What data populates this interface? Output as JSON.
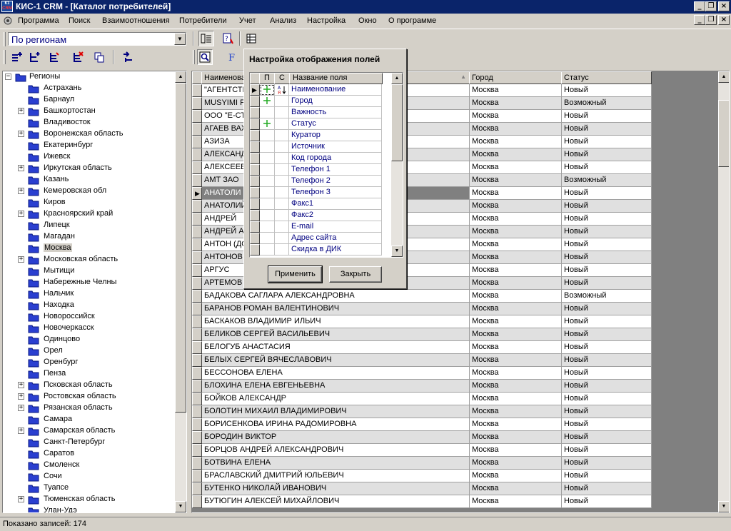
{
  "window": {
    "title": "КИС-1 CRM - [Каталог потребителей]",
    "icon_text": "К1",
    "icon_brand": "CRM"
  },
  "menu": [
    "Программа",
    "Поиск",
    "Взаимоотношения",
    "Потребители",
    "Учет",
    "Анализ",
    "Настройка",
    "Окно",
    "О программе"
  ],
  "toolbar": {
    "group_by": "По регионам"
  },
  "tree": {
    "root": "Регионы",
    "items": [
      {
        "label": "Астрахань",
        "expandable": false
      },
      {
        "label": "Барнаул",
        "expandable": false
      },
      {
        "label": "Башкортостан",
        "expandable": true
      },
      {
        "label": "Владивосток",
        "expandable": false
      },
      {
        "label": "Воронежская область",
        "expandable": true
      },
      {
        "label": "Екатеринбург",
        "expandable": false
      },
      {
        "label": "Ижевск",
        "expandable": false
      },
      {
        "label": "Иркутская область",
        "expandable": true
      },
      {
        "label": "Казань",
        "expandable": false
      },
      {
        "label": "Кемеровская обл",
        "expandable": true
      },
      {
        "label": "Киров",
        "expandable": false
      },
      {
        "label": "Красноярский край",
        "expandable": true
      },
      {
        "label": "Липецк",
        "expandable": false
      },
      {
        "label": "Магадан",
        "expandable": false
      },
      {
        "label": "Москва",
        "expandable": false,
        "selected": true
      },
      {
        "label": "Московская область",
        "expandable": true
      },
      {
        "label": "Мытищи",
        "expandable": false
      },
      {
        "label": "Набережные Челны",
        "expandable": false
      },
      {
        "label": "Нальчик",
        "expandable": false
      },
      {
        "label": "Находка",
        "expandable": false
      },
      {
        "label": "Новороссийск",
        "expandable": false
      },
      {
        "label": "Новочеркасск",
        "expandable": false
      },
      {
        "label": "Одинцово",
        "expandable": false
      },
      {
        "label": "Орел",
        "expandable": false
      },
      {
        "label": "Оренбург",
        "expandable": false
      },
      {
        "label": "Пенза",
        "expandable": false
      },
      {
        "label": "Псковская область",
        "expandable": true
      },
      {
        "label": "Ростовская область",
        "expandable": true
      },
      {
        "label": "Рязанская область",
        "expandable": true
      },
      {
        "label": "Самара",
        "expandable": false
      },
      {
        "label": "Самарская область",
        "expandable": true
      },
      {
        "label": "Санкт-Петербург",
        "expandable": false
      },
      {
        "label": "Саратов",
        "expandable": false
      },
      {
        "label": "Смоленск",
        "expandable": false
      },
      {
        "label": "Сочи",
        "expandable": false
      },
      {
        "label": "Туапсе",
        "expandable": false
      },
      {
        "label": "Тюменская область",
        "expandable": true
      },
      {
        "label": "Улан-Удэ",
        "expandable": false
      }
    ]
  },
  "grid": {
    "columns": [
      "Наименование",
      "Город",
      "Статус"
    ],
    "rows": [
      [
        "\"АГЕНТСТВ",
        "Москва",
        "Новый"
      ],
      [
        "MUSYIMI P",
        "Москва",
        "Возможный"
      ],
      [
        "ООО \"Е-СТ",
        "Москва",
        "Новый"
      ],
      [
        "АГАЕВ ВАХ",
        "Москва",
        "Новый"
      ],
      [
        "АЗИЗА",
        "Москва",
        "Новый"
      ],
      [
        "АЛЕКСАНД",
        "Москва",
        "Новый"
      ],
      [
        "АЛЕКСЕЕВ",
        "Москва",
        "Новый"
      ],
      [
        "АМТ ЗАО",
        "Москва",
        "Возможный"
      ],
      [
        "АНАТОЛИ",
        "Москва",
        "Новый"
      ],
      [
        "АНАТОЛИЙ",
        "Москва",
        "Новый"
      ],
      [
        "АНДРЕЙ",
        "Москва",
        "Новый"
      ],
      [
        "АНДРЕЙ А",
        "Москва",
        "Новый"
      ],
      [
        "АНТОН (ДС",
        "Москва",
        "Новый"
      ],
      [
        "АНТОНОВ",
        "Москва",
        "Новый"
      ],
      [
        "АРГУС",
        "Москва",
        "Новый"
      ],
      [
        "АРТЕМОВ А",
        "Москва",
        "Новый"
      ],
      [
        "БАДАКОВА САГЛАРА АЛЕКСАНДРОВНА",
        "Москва",
        "Возможный"
      ],
      [
        "БАРАНОВ РОМАН ВАЛЕНТИНОВИЧ",
        "Москва",
        "Новый"
      ],
      [
        "БАСКАКОВ ВЛАДИМИР ИЛЬИЧ",
        "Москва",
        "Новый"
      ],
      [
        "БЕЛИКОВ СЕРГЕЙ ВАСИЛЬЕВИЧ",
        "Москва",
        "Новый"
      ],
      [
        "БЕЛОГУБ АНАСТАСИЯ",
        "Москва",
        "Новый"
      ],
      [
        "БЕЛЫХ СЕРГЕЙ ВЯЧЕСЛАВОВИЧ",
        "Москва",
        "Новый"
      ],
      [
        "БЕССОНОВА ЕЛЕНА",
        "Москва",
        "Новый"
      ],
      [
        "БЛОХИНА ЕЛЕНА ЕВГЕНЬЕВНА",
        "Москва",
        "Новый"
      ],
      [
        "БОЙКОВ АЛЕКСАНДР",
        "Москва",
        "Новый"
      ],
      [
        "БОЛОТИН МИХАИЛ ВЛАДИМИРОВИЧ",
        "Москва",
        "Новый"
      ],
      [
        "БОРИСЕНКОВА ИРИНА РАДОМИРОВНА",
        "Москва",
        "Новый"
      ],
      [
        "БОРОДИН ВИКТОР",
        "Москва",
        "Новый"
      ],
      [
        "БОРЦОВ АНДРЕЙ АЛЕКСАНДРОВИЧ",
        "Москва",
        "Новый"
      ],
      [
        "БОТВИНА ЕЛЕНА",
        "Москва",
        "Новый"
      ],
      [
        "БРАСЛАВСКИЙ ДМИТРИЙ ЮЛЬЕВИЧ",
        "Москва",
        "Новый"
      ],
      [
        "БУТЕНКО НИКОЛАЙ ИВАНОВИЧ",
        "Москва",
        "Новый"
      ],
      [
        "БУТЮГИН АЛЕКСЕЙ МИХАЙЛОВИЧ",
        "Москва",
        "Новый"
      ]
    ],
    "selected_row": 8
  },
  "dialog": {
    "title": "Настройка отображения полей",
    "col_p": "П",
    "col_c": "С",
    "col_name": "Название поля",
    "fields": [
      {
        "name": "Наименование",
        "p": true
      },
      {
        "name": "Город",
        "p": true
      },
      {
        "name": "Важность",
        "p": false
      },
      {
        "name": "Статус",
        "p": true
      },
      {
        "name": "Куратор",
        "p": false
      },
      {
        "name": "Источник",
        "p": false
      },
      {
        "name": "Код города",
        "p": false
      },
      {
        "name": "Телефон 1",
        "p": false
      },
      {
        "name": "Телефон 2",
        "p": false
      },
      {
        "name": "Телефон 3",
        "p": false
      },
      {
        "name": "Факс1",
        "p": false
      },
      {
        "name": "Факс2",
        "p": false
      },
      {
        "name": "E-mail",
        "p": false
      },
      {
        "name": "Адрес сайта",
        "p": false
      },
      {
        "name": "Скидка в ДИК",
        "p": false
      }
    ],
    "apply_label": "Применить",
    "close_label": "Закрыть"
  },
  "status": {
    "text": "Показано записей: 174"
  },
  "colors": {
    "titlebar": "#0a246a",
    "folder": "#2a3fd0",
    "link": "#000080",
    "check": "#22aa22"
  }
}
